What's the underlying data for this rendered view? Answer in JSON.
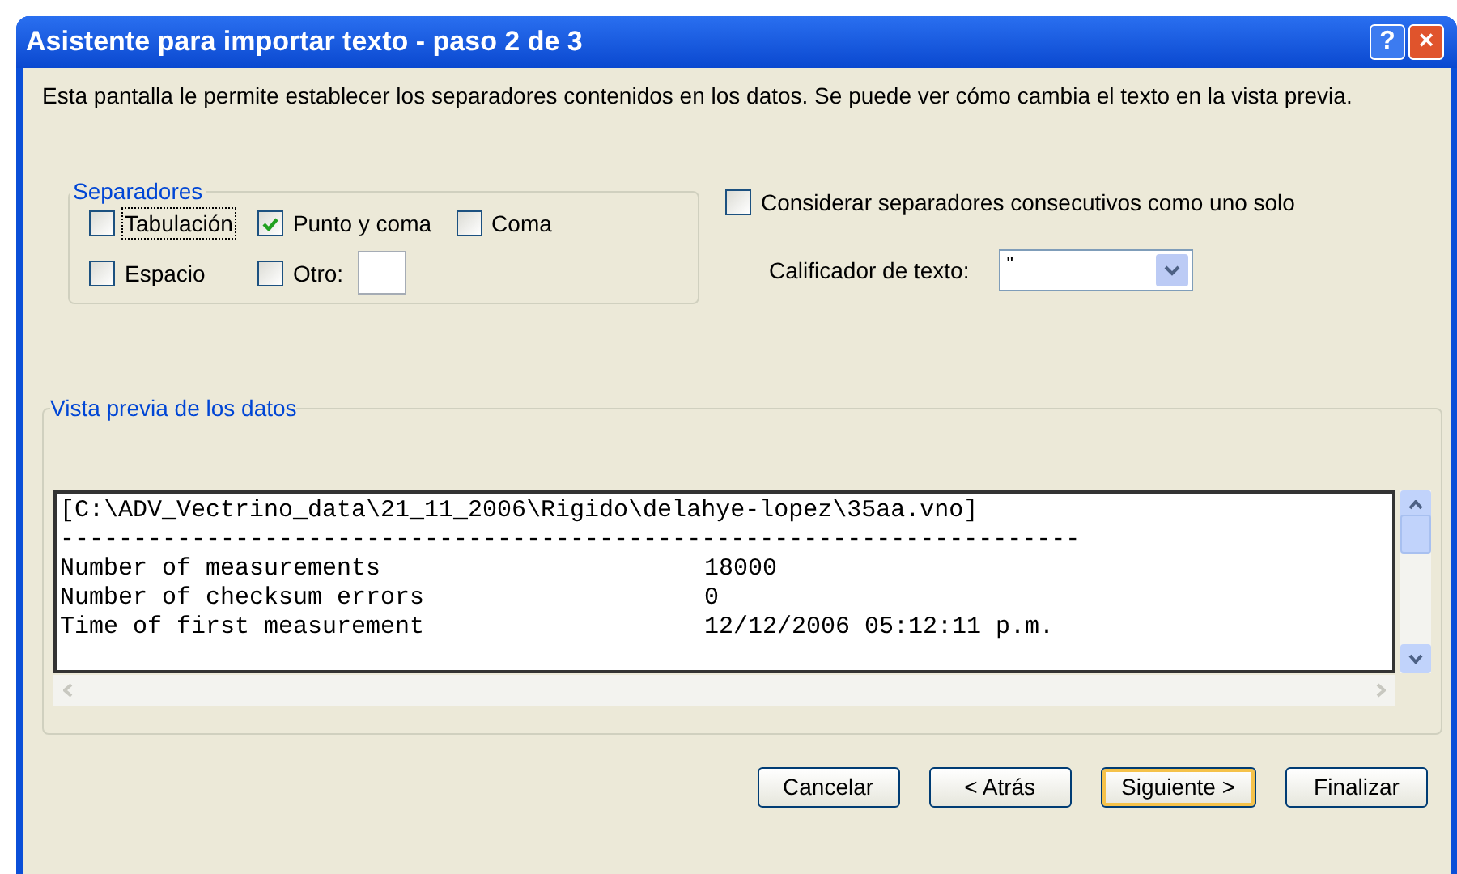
{
  "window": {
    "title": "Asistente para importar texto - paso 2 de 3",
    "title_buttons": [
      "?",
      "×"
    ]
  },
  "intro": "Esta pantalla le permite establecer los separadores contenidos en los datos. Se puede ver cómo cambia el texto en la vista previa.",
  "separators": {
    "title": "Separadores",
    "options": [
      {
        "label": "Tabulación",
        "checked": false,
        "focused": true
      },
      {
        "label": "Punto y coma",
        "checked": true,
        "focused": false
      },
      {
        "label": "Coma",
        "checked": false,
        "focused": false
      },
      {
        "label": "Espacio",
        "checked": false,
        "focused": false
      },
      {
        "label": "Otro:",
        "checked": false,
        "focused": false,
        "has_field": true
      }
    ]
  },
  "consecutive": {
    "label": "Considerar separadores consecutivos como uno solo",
    "checked": false
  },
  "qualifier": {
    "label": "Calificador de texto:",
    "value": "\""
  },
  "preview": {
    "title": "Vista previa de los datos",
    "lines": [
      {
        "kind": "text",
        "text": "[C:\\ADV_Vectrino_data\\21_11_2006\\Rigido\\delahye-lopez\\35aa.vno]"
      },
      {
        "kind": "text",
        "text": "----------------------------------------------------------------------"
      },
      {
        "kind": "pair",
        "label": "Number of measurements",
        "value": "18000"
      },
      {
        "kind": "pair",
        "label": "Number of checksum errors",
        "value": "0"
      },
      {
        "kind": "pair",
        "label": "Time of first measurement",
        "value": "12/12/2006 05:12:11 p.m."
      }
    ]
  },
  "buttons": [
    {
      "label": "Cancelar",
      "default": false
    },
    {
      "label": "< Atrás",
      "default": false
    },
    {
      "label": "Siguiente >",
      "default": true
    },
    {
      "label": "Finalizar",
      "default": false
    }
  ]
}
